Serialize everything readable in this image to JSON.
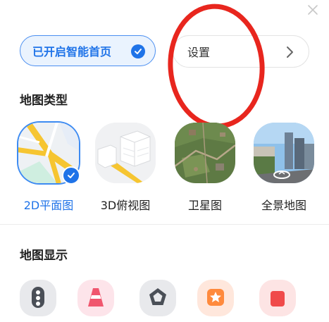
{
  "header": {
    "close_icon": "close-icon"
  },
  "top_row": {
    "smart_home_label": "已开启智能首页",
    "settings_label": "设置"
  },
  "sections": {
    "map_type_title": "地图类型",
    "map_display_title": "地图显示"
  },
  "map_types": [
    {
      "label": "2D平面图",
      "selected": true
    },
    {
      "label": "3D俯视图",
      "selected": false
    },
    {
      "label": "卫星图",
      "selected": false
    },
    {
      "label": "全景地图",
      "selected": false
    }
  ],
  "display_icons": [
    {
      "icon": "traffic-light-icon",
      "color": "#e8e9ec"
    },
    {
      "icon": "traffic-cone-icon",
      "color": "#fde4ea"
    },
    {
      "icon": "pentagon-icon",
      "color": "#e8e9ec"
    },
    {
      "icon": "star-icon",
      "color": "#ffe7dc"
    },
    {
      "icon": "marker-icon",
      "color": "#fde4e4"
    }
  ],
  "colors": {
    "accent": "#1f73e8",
    "annotation_circle": "#e8261e"
  }
}
